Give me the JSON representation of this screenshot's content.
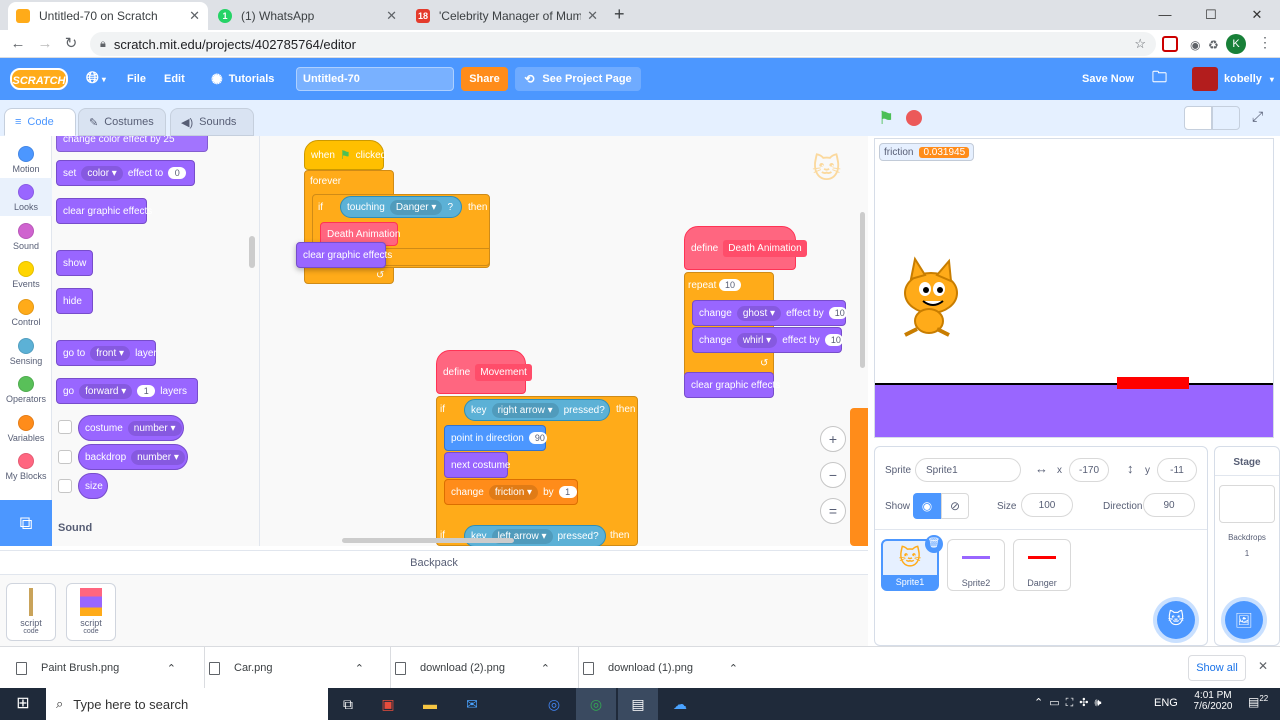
{
  "browser": {
    "tabs": [
      {
        "title": "Untitled-70 on Scratch",
        "favicon_color": "#ffab19"
      },
      {
        "title": "(1) WhatsApp",
        "favicon_color": "#25d366",
        "favicon_text": "1"
      },
      {
        "title": "'Celebrity Manager of Mumbai'",
        "favicon_color": "#e43b2c",
        "favicon_text": "18"
      }
    ],
    "url": "scratch.mit.edu/projects/402785764/editor",
    "profile_initial": "K"
  },
  "menu": {
    "logo": "SCRATCH",
    "file": "File",
    "edit": "Edit",
    "tutorials": "Tutorials",
    "project_title": "Untitled-70",
    "share": "Share",
    "see_project": "See Project Page",
    "save_now": "Save Now",
    "username": "kobelly"
  },
  "editor_tabs": {
    "code": "Code",
    "costumes": "Costumes",
    "sounds": "Sounds"
  },
  "categories": [
    {
      "label": "Motion",
      "color": "#4c97ff"
    },
    {
      "label": "Looks",
      "color": "#9966ff"
    },
    {
      "label": "Sound",
      "color": "#cf63cf"
    },
    {
      "label": "Events",
      "color": "#ffd500"
    },
    {
      "label": "Control",
      "color": "#ffab19"
    },
    {
      "label": "Sensing",
      "color": "#5cb1d6"
    },
    {
      "label": "Operators",
      "color": "#59c059"
    },
    {
      "label": "Variables",
      "color": "#ff8c1a"
    },
    {
      "label": "My Blocks",
      "color": "#ff6680"
    }
  ],
  "palette": {
    "change_effect": "change color effect by 25",
    "set_label": "set",
    "color_opt": "color",
    "effect_to": "effect to",
    "effect_val": "0",
    "clear_effects": "clear graphic effects",
    "show": "show",
    "hide": "hide",
    "go_to": "go to",
    "front": "front",
    "layer": "layer",
    "go": "go",
    "forward": "forward",
    "layers_val": "1",
    "layers": "layers",
    "costume": "costume",
    "number": "number",
    "backdrop": "backdrop",
    "size": "size",
    "sound_heading": "Sound"
  },
  "workspace": {
    "when": "when",
    "clicked": "clicked",
    "forever": "forever",
    "if": "if",
    "touching": "touching",
    "danger": "Danger",
    "q": "?",
    "then": "then",
    "death_anim": "Death Animation",
    "clear_effects": "clear graphic effects",
    "define": "define",
    "movement": "Movement",
    "key": "key",
    "right_arrow": "right arrow",
    "left_arrow": "left arrow",
    "pressed": "pressed?",
    "point_dir": "point in direction",
    "dir_val": "90",
    "next_costume": "next costume",
    "change": "change",
    "friction": "friction",
    "by": "by",
    "friction_val": "1",
    "repeat": "repeat",
    "repeat_val": "10",
    "ghost": "ghost",
    "whirl": "whirl",
    "effect_by": "effect by",
    "ghost_val": "10",
    "whirl_val": "10"
  },
  "zoom": {
    "in": "+",
    "out": "−",
    "reset": "="
  },
  "backpack": {
    "title": "Backpack",
    "items": [
      {
        "label": "script",
        "sub": "code"
      },
      {
        "label": "script",
        "sub": "code"
      }
    ]
  },
  "stage": {
    "monitor_name": "friction",
    "monitor_value": "0.031945",
    "ground_color": "#9966ff",
    "danger_color": "#ff0000"
  },
  "sprite_info": {
    "sprite_label": "Sprite",
    "sprite_name": "Sprite1",
    "x_label": "x",
    "x": "-170",
    "y_label": "y",
    "y": "-11",
    "show_label": "Show",
    "size_label": "Size",
    "size": "100",
    "direction_label": "Direction",
    "direction": "90"
  },
  "sprites": [
    {
      "name": "Sprite1",
      "selected": true
    },
    {
      "name": "Sprite2",
      "line_color": "#9966ff"
    },
    {
      "name": "Danger",
      "line_color": "#ff0000"
    }
  ],
  "stage_pane": {
    "title": "Stage",
    "backdrops_label": "Backdrops",
    "backdrops_count": "1"
  },
  "downloads": [
    {
      "name": "Paint Brush.png"
    },
    {
      "name": "Car.png"
    },
    {
      "name": "download (2).png"
    },
    {
      "name": "download (1).png"
    }
  ],
  "downloads_show_all": "Show all",
  "taskbar": {
    "search_placeholder": "Type here to search",
    "lang": "ENG",
    "time": "4:01 PM",
    "date": "7/6/2020",
    "notif_count": "22"
  }
}
